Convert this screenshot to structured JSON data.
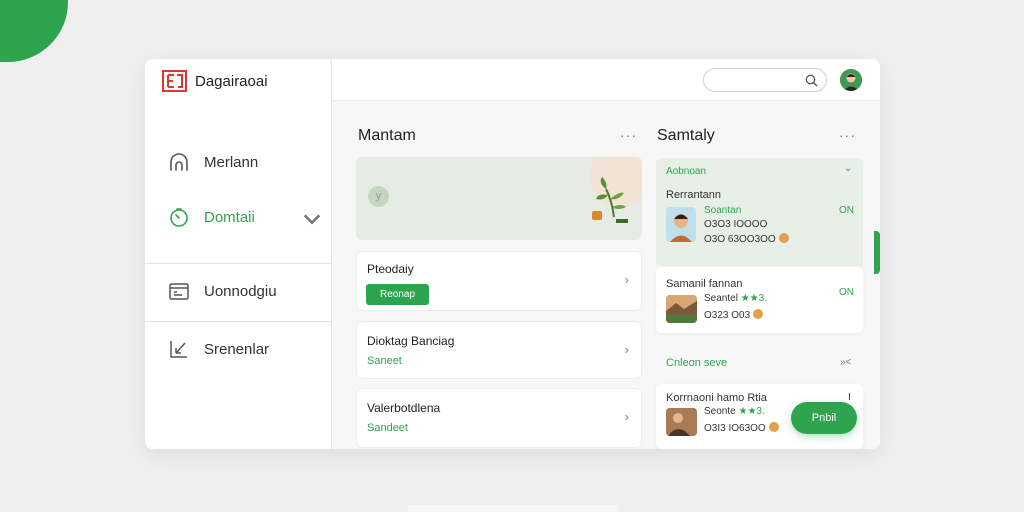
{
  "brand": {
    "name": "Dagairaoai"
  },
  "sidebar": {
    "items": [
      {
        "label": "Merlann",
        "icon": "home-icon"
      },
      {
        "label": "Domtaii",
        "icon": "clock-icon"
      },
      {
        "label": "Uonnodgiu",
        "icon": "calendar-icon"
      },
      {
        "label": "Srenenlar",
        "icon": "edit-icon"
      }
    ]
  },
  "topbar": {
    "search_placeholder": ""
  },
  "main": {
    "title": "Mantam",
    "more": "···",
    "hero_badge": "y",
    "cards": [
      {
        "title": "Pteodaiy",
        "button": "Reonap"
      },
      {
        "title": "Dioktag Banciag",
        "sub": "Saneet"
      },
      {
        "title": "Valerbotdlena",
        "sub": "Sandeet"
      }
    ]
  },
  "summary": {
    "title": "Samtaly",
    "more": "···",
    "panel_header": "Aobnoan",
    "panel_chevron": "⌄",
    "entries": [
      {
        "heading": "Rerrantann",
        "name": "Soantan",
        "line2": "O3O3 IOOOO",
        "line3": "O3O 63OO3OO",
        "tag": "ON"
      },
      {
        "heading": "Samanil fannan",
        "name": "Seantel",
        "stars": "★★3.",
        "line3": "O323 O03",
        "tag": "ON"
      }
    ],
    "section2": {
      "title": "Cnleon seve",
      "icon_text": "»<"
    },
    "entry3": {
      "heading": "Korrnaoni hamo Rtia",
      "name": "Seonte",
      "stars": "★★3.",
      "line3": "O3I3 IO63OO",
      "tag": "I"
    },
    "fab_label": "Pnbil"
  },
  "colors": {
    "accent": "#2ea44f",
    "brand_red": "#d83a2e"
  }
}
